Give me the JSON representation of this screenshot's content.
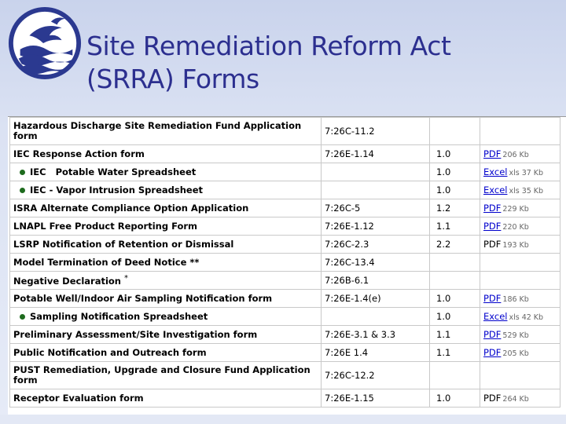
{
  "title": {
    "line1": "Site Remediation Reform Act",
    "line2": "(SRRA) Forms"
  },
  "logo": {
    "icon": "nj-dep-seal-icon",
    "bg": "#2b3990"
  },
  "rows": [
    {
      "form": "Hazardous Discharge Site Remediation Fund Application form",
      "rule": "7:26C-11.2",
      "ver": "",
      "fmt": "",
      "size": "",
      "sub": false,
      "tall": true
    },
    {
      "form": "IEC Response Action form",
      "rule": "7:26E-1.14",
      "ver": "1.0",
      "fmt": "PDF",
      "size": "206 Kb",
      "sub": false,
      "tall": false
    },
    {
      "form": "IEC",
      "form2": "Potable Water Spreadsheet",
      "rule": "",
      "ver": "1.0",
      "fmt": "Excel",
      "size": "xls 37 Kb",
      "sub": true,
      "tall": false
    },
    {
      "form": "IEC - Vapor Intrusion Spreadsheet",
      "rule": "",
      "ver": "1.0",
      "fmt": "Excel",
      "size": "xls 35 Kb",
      "sub": true,
      "tall": false
    },
    {
      "form": "ISRA Alternate Compliance Option Application",
      "rule": "7:26C-5",
      "ver": "1.2",
      "fmt": "PDF",
      "size": "229 Kb",
      "sub": false,
      "tall": false
    },
    {
      "form": "LNAPL Free Product Reporting Form",
      "rule": "7:26E-1.12",
      "ver": "1.1",
      "fmt": "PDF",
      "size": "220 Kb",
      "sub": false,
      "tall": false
    },
    {
      "form": "LSRP Notification of Retention or Dismissal",
      "rule": "7:26C-2.3",
      "ver": "2.2",
      "fmt": "PDF",
      "size": "193 Kb",
      "sub": false,
      "tall": false,
      "fmtPlain": true
    },
    {
      "form": "Model Termination of Deed Notice **",
      "rule": "7:26C-13.4",
      "ver": "",
      "fmt": "",
      "size": "",
      "sub": false,
      "tall": false
    },
    {
      "form": "Negative Declaration",
      "ast": "*",
      "rule": "7:26B-6.1",
      "ver": "",
      "fmt": "",
      "size": "",
      "sub": false,
      "tall": false
    },
    {
      "form": "Potable Well/Indoor Air Sampling Notification form",
      "rule": "7:26E-1.4(e)",
      "ver": "1.0",
      "fmt": "PDF",
      "size": "186 Kb",
      "sub": false,
      "tall": false
    },
    {
      "form": "Sampling Notification Spreadsheet",
      "rule": "",
      "ver": "1.0",
      "fmt": "Excel",
      "size": "xls 42 Kb",
      "sub": true,
      "tall": false
    },
    {
      "form": "Preliminary Assessment/Site Investigation form",
      "rule": "7:26E-3.1 & 3.3",
      "ver": "1.1",
      "fmt": "PDF",
      "size": "529 Kb",
      "sub": false,
      "tall": false
    },
    {
      "form": "Public Notification and Outreach form",
      "rule": "7:26E 1.4",
      "ver": "1.1",
      "fmt": "PDF",
      "size": "205 Kb",
      "sub": false,
      "tall": false
    },
    {
      "form": "PUST Remediation, Upgrade and Closure Fund Application form",
      "rule": "7:26C-12.2",
      "ver": "",
      "fmt": "",
      "size": "",
      "sub": false,
      "tall": true
    },
    {
      "form": "Receptor Evaluation form",
      "rule": "7:26E-1.15",
      "ver": "1.0",
      "fmt": "PDF",
      "size": "264 Kb",
      "sub": false,
      "tall": false,
      "fmtPlain": true
    }
  ]
}
